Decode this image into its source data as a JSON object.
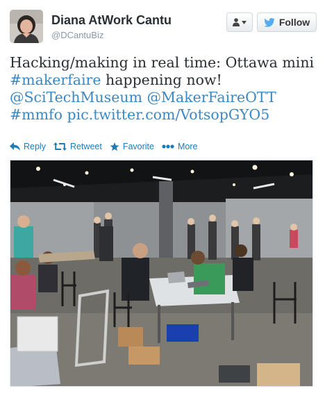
{
  "user": {
    "name": "Diana AtWork Cantu",
    "handle": "@DCantuBiz"
  },
  "buttons": {
    "follow_label": "Follow"
  },
  "tweet": {
    "segments": [
      {
        "text": "Hacking/making in real time: Ottawa mini",
        "link": false
      },
      {
        "text": "#makerfaire",
        "link": true
      },
      {
        "text": " happening now!",
        "link": false
      },
      {
        "text": "@SciTechMuseum",
        "link": true
      },
      {
        "text": "@MakerFaireOTT",
        "link": true
      },
      {
        "text": "#mmfo",
        "link": true
      },
      {
        "text": "pic.twitter.com/VotsopGYO5",
        "link": true
      }
    ]
  },
  "actions": {
    "reply": "Reply",
    "retweet": "Retweet",
    "favorite": "Favorite",
    "more": "More"
  },
  "colors": {
    "link": "#3b88c3",
    "action": "#1f7bb6",
    "follow_bird": "#55acee"
  }
}
